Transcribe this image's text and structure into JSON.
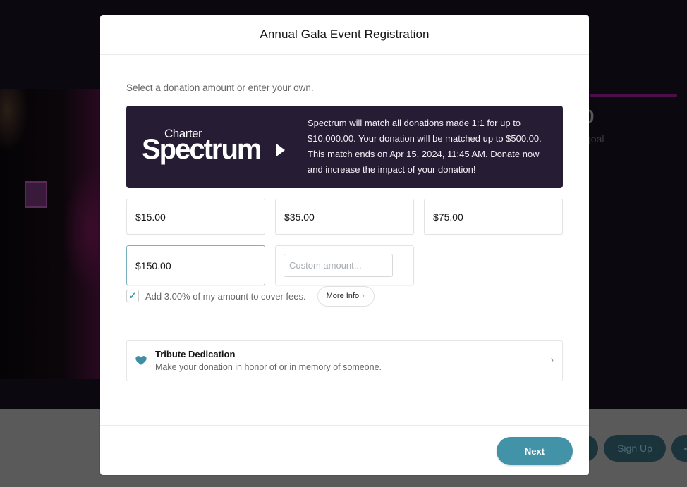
{
  "background": {
    "raised_amount_fragment": "0",
    "goal_fragment": "goal",
    "buttons": [
      {
        "label": ""
      },
      {
        "label": "Sign Up"
      },
      {
        "label": "•"
      }
    ]
  },
  "modal": {
    "title": "Annual Gala Event Registration",
    "intro": "Select a donation amount or enter your own.",
    "sponsor": {
      "logo_top": "Charter",
      "logo_main": "Spectrum",
      "logo_icon": "play-arrow-icon",
      "message": "Spectrum will match all donations made 1:1 for up to $10,000.00. Your donation will be matched up to $500.00. This match ends on Apr 15, 2024, 11:45 AM. Donate now and increase the impact of your donation!"
    },
    "amounts": [
      {
        "label": "$15.00",
        "selected": false
      },
      {
        "label": "$35.00",
        "selected": false
      },
      {
        "label": "$75.00",
        "selected": false
      },
      {
        "label": "$150.00",
        "selected": true
      }
    ],
    "custom_amount": {
      "value": "",
      "placeholder": "Custom amount..."
    },
    "fees": {
      "checked": true,
      "check_glyph": "✓",
      "label": "Add 3.00% of my amount to cover fees.",
      "more_info_label": "More Info",
      "more_info_chevron": "›"
    },
    "tribute": {
      "icon": "heart-icon",
      "title": "Tribute Dedication",
      "subtitle": "Make your donation in honor of or in memory of someone.",
      "chevron": "›"
    },
    "footer": {
      "next_label": "Next"
    }
  },
  "colors": {
    "accent": "#4393a8",
    "sponsor_bg": "#261c33",
    "selected_border": "#7ab3bf"
  }
}
